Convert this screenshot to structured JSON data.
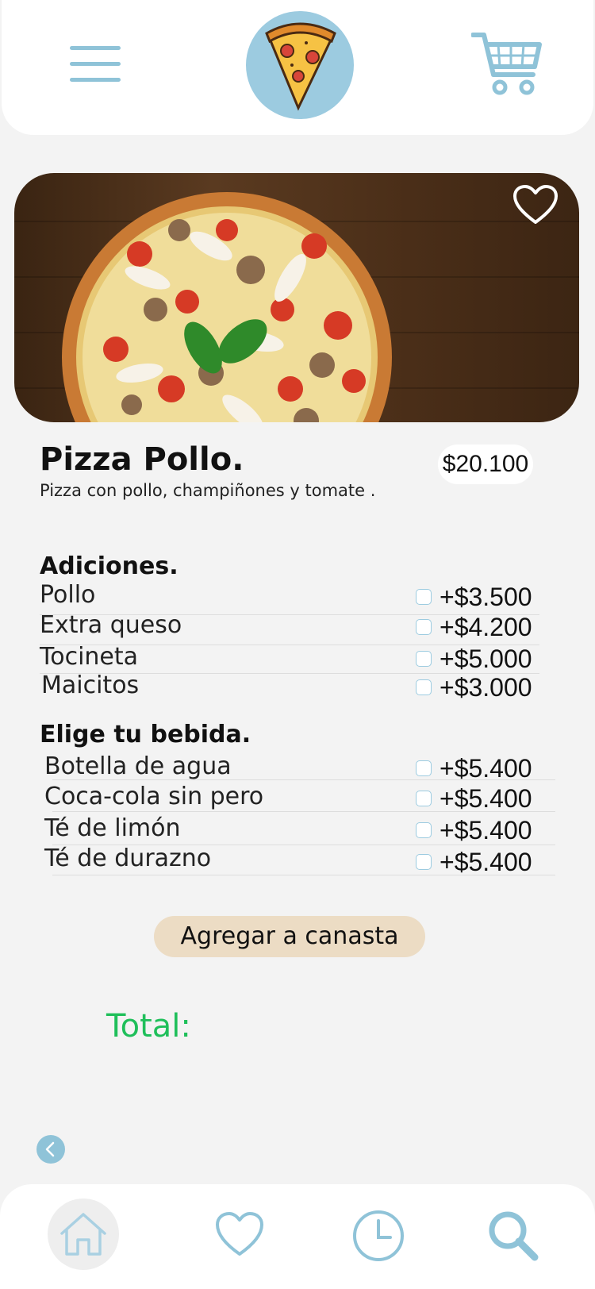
{
  "header": {
    "menu_icon": "menu-icon",
    "logo_icon": "pizza-slice-icon",
    "cart_icon": "shopping-cart-icon"
  },
  "product": {
    "title": "Pizza Pollo.",
    "description": "Pizza con pollo, champiñones y  tomate .",
    "price": "$20.100",
    "favorite_icon": "heart-outline-icon"
  },
  "additions": {
    "title": "Adiciones.",
    "items": [
      {
        "label": "Pollo",
        "price": "+$3.500",
        "checked": false
      },
      {
        "label": "Extra queso",
        "price": "+$4.200",
        "checked": false
      },
      {
        "label": "Tocineta",
        "price": "+$5.000",
        "checked": false
      },
      {
        "label": "Maicitos",
        "price": "+$3.000",
        "checked": false
      }
    ]
  },
  "drinks": {
    "title": "Elige tu bebida.",
    "items": [
      {
        "label": "Botella de agua",
        "price": "+$5.400",
        "checked": false
      },
      {
        "label": "Coca-cola sin pero",
        "price": "+$5.400",
        "checked": false
      },
      {
        "label": "Té de limón",
        "price": "+$5.400",
        "checked": false
      },
      {
        "label": "Té de durazno",
        "price": "+$5.400",
        "checked": false
      }
    ]
  },
  "cta": {
    "label": "Agregar a canasta"
  },
  "total": {
    "label": "Total:"
  },
  "colors": {
    "accent": "#8fc3d8",
    "cta_bg": "#ecdcc4",
    "total_green": "#1fbf5a",
    "background": "#f3f3f3"
  },
  "tabbar": {
    "items": [
      {
        "icon": "home-icon",
        "active": true
      },
      {
        "icon": "heart-icon",
        "active": false
      },
      {
        "icon": "clock-icon",
        "active": false
      },
      {
        "icon": "search-icon",
        "active": false
      }
    ]
  }
}
